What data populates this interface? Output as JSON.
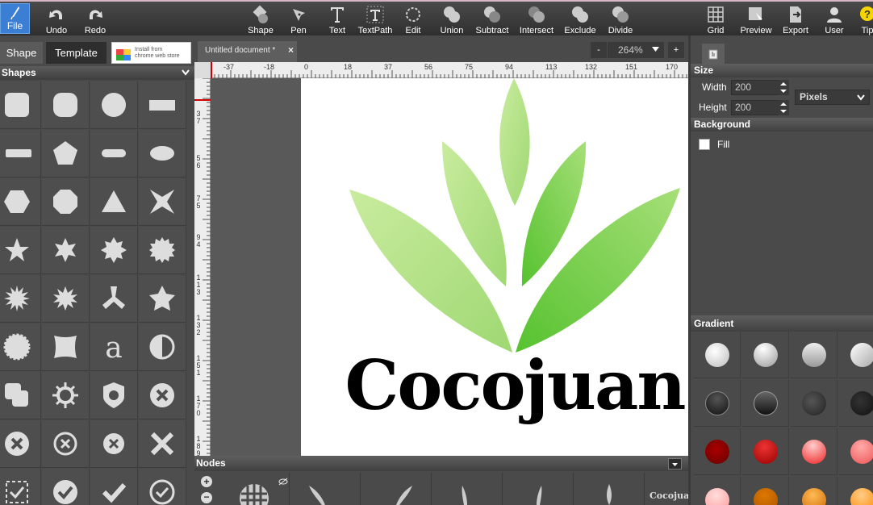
{
  "toolbar": {
    "file": "File",
    "undo": "Undo",
    "redo": "Redo",
    "tools": [
      "Shape",
      "Pen",
      "Text",
      "TextPath",
      "Edit",
      "Union",
      "Subtract",
      "Intersect",
      "Exclude",
      "Divide"
    ],
    "right_tools": [
      "Grid",
      "Preview",
      "Export",
      "User",
      "Tip"
    ]
  },
  "left_panel": {
    "tab_shape": "Shape",
    "tab_template": "Template",
    "store_line1": "Install from",
    "store_line2": "chrome web store",
    "section_title": "Shapes"
  },
  "document": {
    "tab_title": "Untitled document *",
    "close": "×",
    "zoom_minus": "-",
    "zoom_value": "264%",
    "zoom_plus": "+",
    "hruler_labels": [
      "-37",
      "-18",
      "0",
      "18",
      "37",
      "56",
      "75",
      "94",
      "113",
      "132",
      "151",
      "170"
    ],
    "vruler_labels": [
      "37",
      "56",
      "75",
      "94",
      "113",
      "132",
      "151",
      "170",
      "189"
    ],
    "logo_text": "Cocojuan",
    "colors": {
      "leaf_light": "#c9ec9e",
      "leaf_dark": "#56c22f",
      "text": "#000000"
    }
  },
  "nodes": {
    "title": "Nodes"
  },
  "right_panel": {
    "size_title": "Size",
    "width_label": "Width",
    "width_value": "200",
    "height_label": "Height",
    "height_value": "200",
    "unit": "Pixels",
    "background_title": "Background",
    "fill_label": "Fill",
    "gradient_title": "Gradient"
  }
}
